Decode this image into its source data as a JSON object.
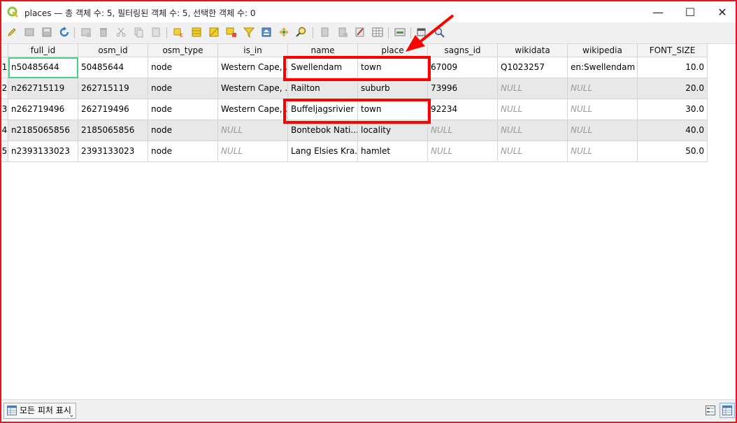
{
  "window": {
    "title": "places — 총 객체 수: 5, 필터링된 객체 수: 5, 선택한 객체 수: 0",
    "minimize_glyph": "—",
    "maximize_glyph": "☐",
    "close_glyph": "✕"
  },
  "toolbar_icons": [
    "toggle-editing-icon",
    "multi-edit-icon",
    "save-edits-icon",
    "reload-icon",
    "add-feature-icon",
    "delete-feature-icon",
    "cut-icon",
    "copy-icon",
    "paste-icon",
    "expression-select-icon",
    "select-all-icon",
    "invert-selection-icon",
    "deselect-icon",
    "filter-icon",
    "move-selection-top-icon",
    "pan-to-selection-icon",
    "zoom-to-selection-icon",
    "new-field-icon",
    "delete-field-icon",
    "field-calculator-icon",
    "conditional-format-icon",
    "dock-icon",
    "actions-icon"
  ],
  "table": {
    "columns": [
      "full_id",
      "osm_id",
      "osm_type",
      "is_in",
      "name",
      "place",
      "sagns_id",
      "wikidata",
      "wikipedia",
      "FONT_SIZE"
    ],
    "row_numbers": [
      "1",
      "2",
      "3",
      "4",
      "5"
    ],
    "rows": [
      [
        "n50485644",
        "50485644",
        "node",
        "Western Cape, ...",
        "Swellendam",
        "town",
        "67009",
        "Q1023257",
        "en:Swellendam",
        "10.0"
      ],
      [
        "n262715119",
        "262715119",
        "node",
        "Western Cape, ...",
        "Railton",
        "suburb",
        "73996",
        "NULL",
        "NULL",
        "20.0"
      ],
      [
        "n262719496",
        "262719496",
        "node",
        "Western Cape, ...",
        "Buffeljagsrivier",
        "town",
        "92234",
        "NULL",
        "NULL",
        "30.0"
      ],
      [
        "n2185065856",
        "2185065856",
        "node",
        "NULL",
        "Bontebok Nati...",
        "locality",
        "NULL",
        "NULL",
        "NULL",
        "40.0"
      ],
      [
        "n2393133023",
        "2393133023",
        "node",
        "NULL",
        "Lang Elsies Kra...",
        "hamlet",
        "NULL",
        "NULL",
        "NULL",
        "50.0"
      ]
    ]
  },
  "status": {
    "show_all_label": "모든 피처 표시",
    "caret_glyph": "⌄"
  },
  "colors": {
    "annotation_red": "#ff0000",
    "frame_red": "#e8151f",
    "focus_green": "#4ccf8a"
  }
}
